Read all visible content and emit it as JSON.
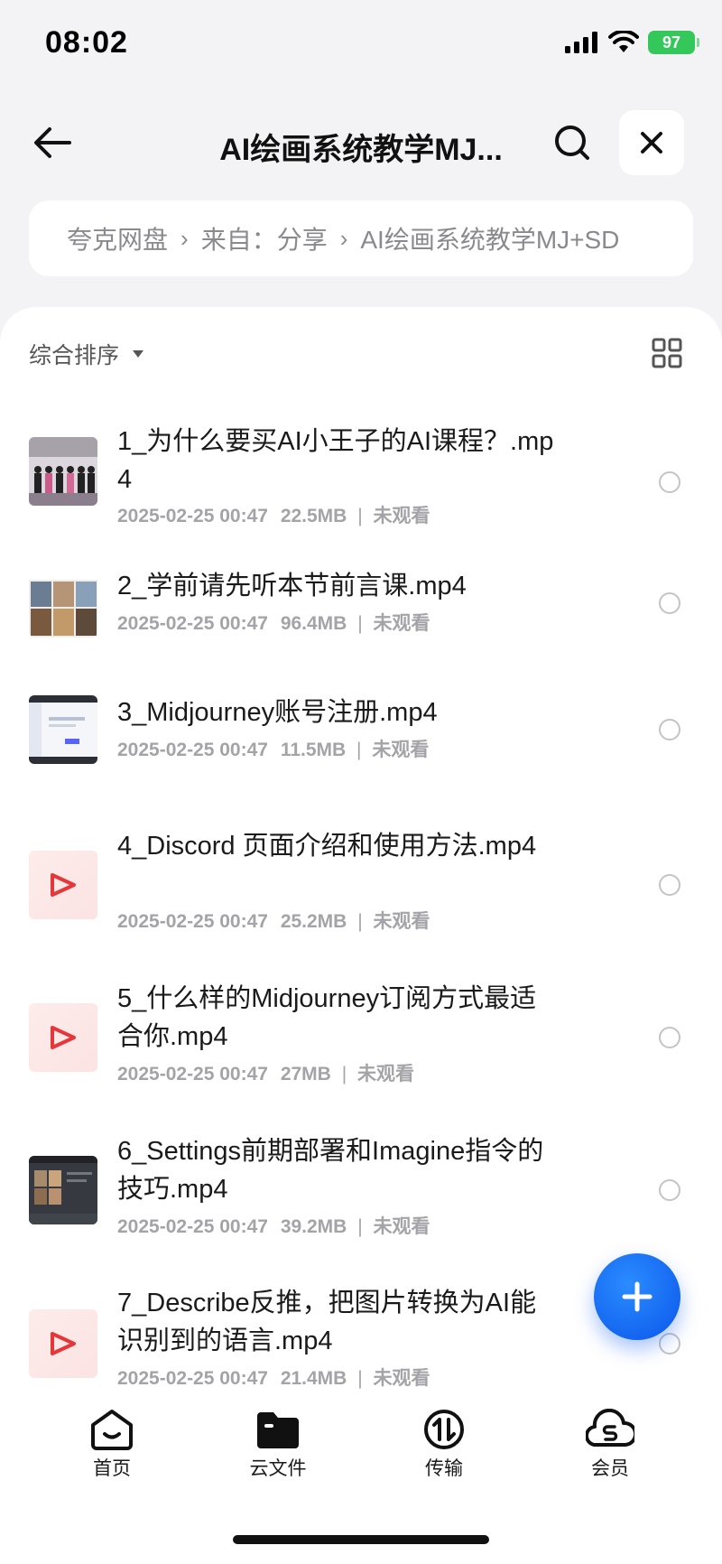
{
  "status_bar": {
    "time": "08:02",
    "battery": "97"
  },
  "header": {
    "title": "AI绘画系统教学MJ..."
  },
  "breadcrumb": {
    "items": [
      "夸克网盘",
      "来自：分享",
      "AI绘画系统教学MJ+SD"
    ],
    "separator": "›"
  },
  "toolbar": {
    "sort_label": "综合排序"
  },
  "files": [
    {
      "name": "1_为什么要买AI小王子的AI课程？.mp4",
      "date": "2025-02-25 00:47",
      "size": "22.5MB",
      "status": "未观看",
      "thumb": "photo-group"
    },
    {
      "name": "2_学前请先听本节前言课.mp4",
      "date": "2025-02-25 00:47",
      "size": "96.4MB",
      "status": "未观看",
      "thumb": "photo-grid"
    },
    {
      "name": "3_Midjourney账号注册.mp4",
      "date": "2025-02-25 00:47",
      "size": "11.5MB",
      "status": "未观看",
      "thumb": "screenshot"
    },
    {
      "name": "4_Discord 页面介绍和使用方法.mp4",
      "date": "2025-02-25 00:47",
      "size": "25.2MB",
      "status": "未观看",
      "thumb": "video-icon"
    },
    {
      "name": "5_什么样的Midjourney订阅方式最适合你.mp4",
      "date": "2025-02-25 00:47",
      "size": "27MB",
      "status": "未观看",
      "thumb": "video-icon"
    },
    {
      "name": "6_Settings前期部署和Imagine指令的技巧.mp4",
      "date": "2025-02-25 00:47",
      "size": "39.2MB",
      "status": "未观看",
      "thumb": "dark-screenshot"
    },
    {
      "name": "7_Describe反推，把图片转换为AI能识别到的语言.mp4",
      "date": "2025-02-25 00:47",
      "size": "21.4MB",
      "status": "未观看",
      "thumb": "video-icon"
    }
  ],
  "tabbar": {
    "items": [
      {
        "label": "首页",
        "icon": "home-icon"
      },
      {
        "label": "云文件",
        "icon": "folder-icon"
      },
      {
        "label": "传输",
        "icon": "transfer-icon"
      },
      {
        "label": "会员",
        "icon": "vip-icon"
      }
    ]
  },
  "colors": {
    "accent": "#0a56ea",
    "battery": "#34c759",
    "video_icon": "#e5373a"
  }
}
